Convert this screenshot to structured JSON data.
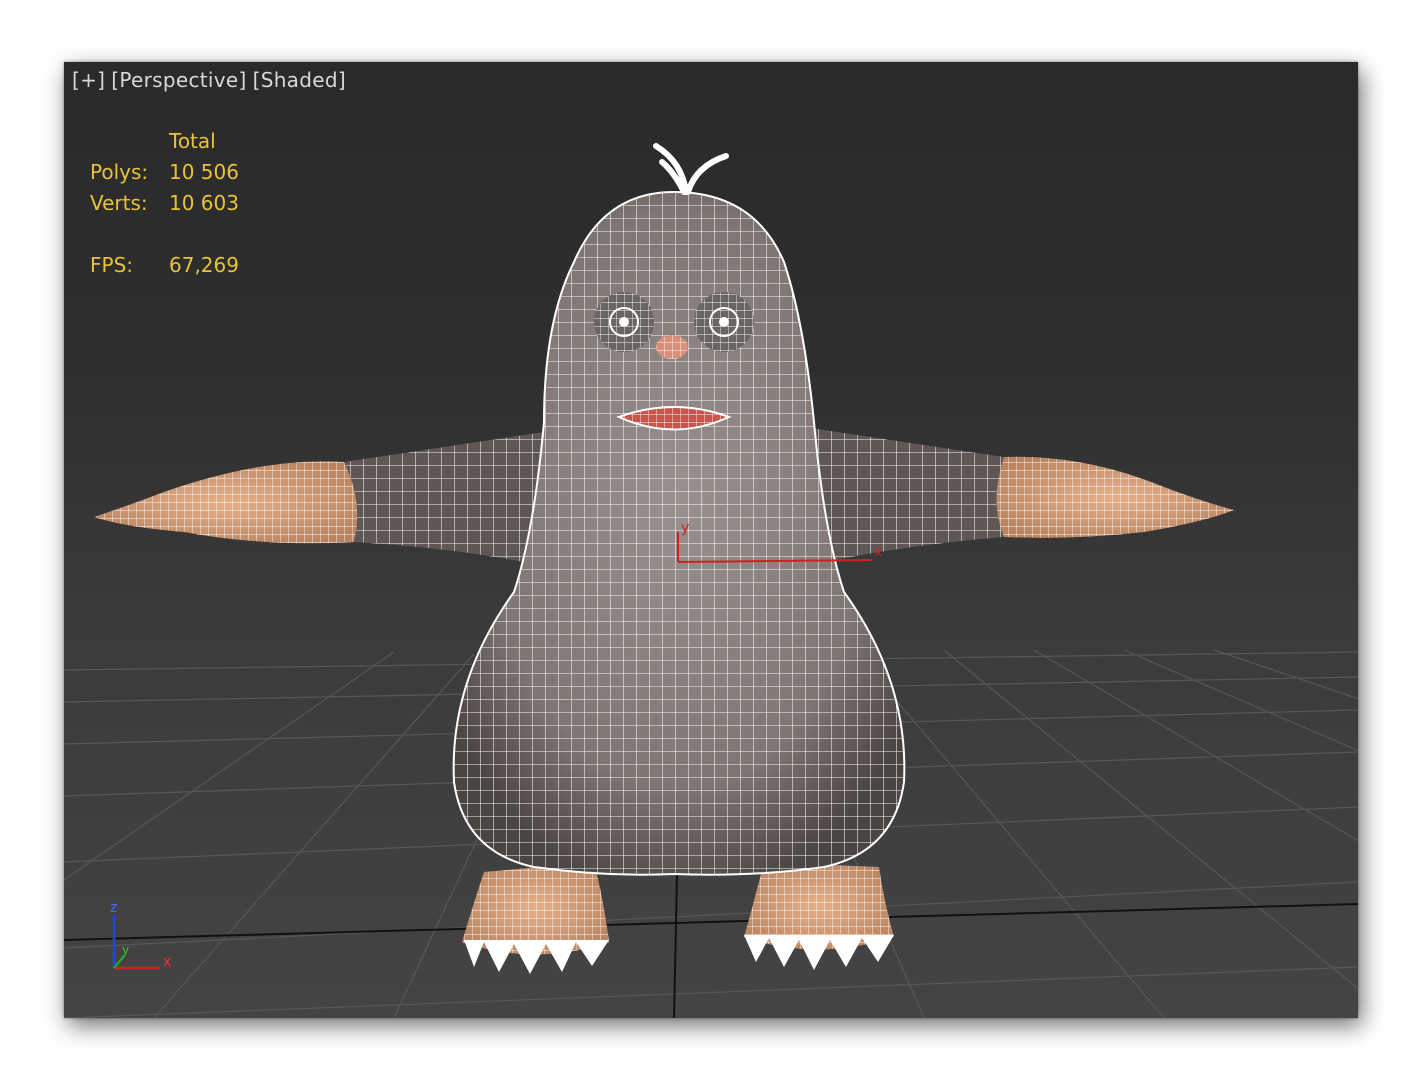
{
  "viewport": {
    "labels": [
      "[+]",
      "[Perspective]",
      "[Shaded]"
    ]
  },
  "stats": {
    "header": "Total",
    "polys_label": "Polys:",
    "polys_value": "10 506",
    "verts_label": "Verts:",
    "verts_value": "10 603",
    "fps_label": "FPS:",
    "fps_value": "67,269"
  },
  "axes": {
    "world": {
      "x": "x",
      "y": "y",
      "z": "z"
    },
    "pivot": {
      "x": "x",
      "y": "y"
    }
  },
  "colors": {
    "stats_text": "#e8c33a",
    "label_text": "#d8d8d8",
    "mesh_wire": "#ffffff",
    "body_shade": "#8d8380",
    "skin": "#d9a07a",
    "axis_x": "#cc2222",
    "axis_y": "#22aa22",
    "axis_z": "#2244dd"
  }
}
